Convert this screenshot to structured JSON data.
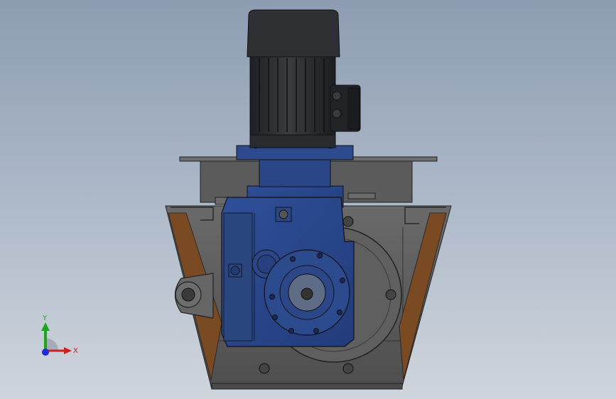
{
  "viewport": {
    "background_top": "#8d9cb2",
    "background_bottom": "#cfd5dd"
  },
  "model": {
    "motor_color": "#2b2d31",
    "gearbox_color": "#2d4a8f",
    "housing_color": "#595959",
    "plate_color": "#7a4a22"
  },
  "triad": {
    "y_label": "Y",
    "x_label": "X",
    "y_color": "#1aa51a",
    "x_color": "#d11f1f",
    "z_color": "#1e2bd6"
  }
}
